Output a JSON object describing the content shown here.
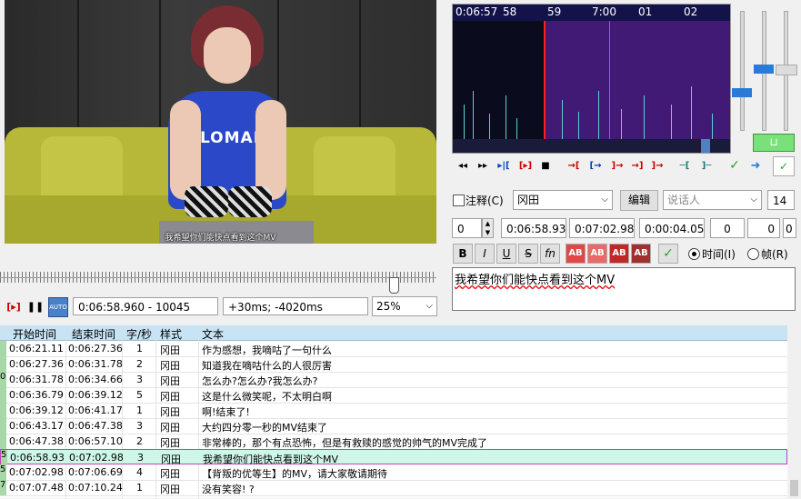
{
  "video": {
    "subtitle": "我希望你们能快点看到这个MV",
    "shirt_text": "GLOMAR"
  },
  "playback": {
    "position": "0:06:58.960 - 10045",
    "offset": "+30ms; -4020ms",
    "zoom": "25%"
  },
  "waveform": {
    "ticks": [
      "0:06:57",
      "58",
      "59",
      "7:00",
      "01",
      "02"
    ]
  },
  "editor": {
    "comment_label": "注释(C)",
    "style": "冈田",
    "edit_button": "编辑",
    "actor_placeholder": "说话人",
    "font_size": "14",
    "layer": "0",
    "start": "0:06:58.93",
    "end": "0:07:02.98",
    "duration": "0:00:04.05",
    "margin_l": "0",
    "margin_r": "0",
    "margin_v": "0",
    "bold": "B",
    "italic": "I",
    "underline": "U",
    "strike": "S",
    "fn": "fn",
    "ab": "AB",
    "time_radio": "时间(I)",
    "frame_radio": "帧(R)",
    "text": "我希望你们能快点看到这个MV"
  },
  "grid": {
    "headers": [
      "开始时间",
      "结束时间",
      "字/秒",
      "样式",
      "文本"
    ],
    "rows": [
      {
        "n": "",
        "start": "0:06:21.11",
        "end": "0:06:27.36",
        "cps": "1",
        "style": "冈田",
        "text": "作为感想，我嘀咕了一句什么"
      },
      {
        "n": "",
        "start": "0:06:27.36",
        "end": "0:06:31.78",
        "cps": "2",
        "style": "冈田",
        "text": "知道我在嘀咕什么的人很厉害"
      },
      {
        "n": "0",
        "start": "0:06:31.78",
        "end": "0:06:34.66",
        "cps": "3",
        "style": "冈田",
        "text": "怎么办?怎么办?我怎么办?"
      },
      {
        "n": "",
        "start": "0:06:36.79",
        "end": "0:06:39.12",
        "cps": "5",
        "style": "冈田",
        "text": "这是什么微笑呢，不太明白啊"
      },
      {
        "n": "",
        "start": "0:06:39.12",
        "end": "0:06:41.17",
        "cps": "1",
        "style": "冈田",
        "text": "啊!结束了!"
      },
      {
        "n": "",
        "start": "0:06:43.17",
        "end": "0:06:47.38",
        "cps": "3",
        "style": "冈田",
        "text": "大约四分零一秒的MV结束了"
      },
      {
        "n": "",
        "start": "0:06:47.38",
        "end": "0:06:57.10",
        "cps": "2",
        "style": "冈田",
        "text": "非常棒的，那个有点恐怖，但是有救赎的感觉的帅气的MV完成了"
      },
      {
        "n": "5",
        "start": "0:06:58.93",
        "end": "0:07:02.98",
        "cps": "3",
        "style": "冈田",
        "text": "我希望你们能快点看到这个MV"
      },
      {
        "n": "5",
        "start": "0:07:02.98",
        "end": "0:07:06.69",
        "cps": "4",
        "style": "冈田",
        "text": "【背叛的优等生】的MV，请大家敬请期待"
      },
      {
        "n": "7",
        "start": "0:07:07.48",
        "end": "0:07:10.24",
        "cps": "1",
        "style": "冈田",
        "text": "没有笑容! ?"
      }
    ]
  },
  "colors": {
    "selected_row": "#cff7e8",
    "header": "#c8e3f4",
    "spectro_selection": "#6e28be"
  }
}
